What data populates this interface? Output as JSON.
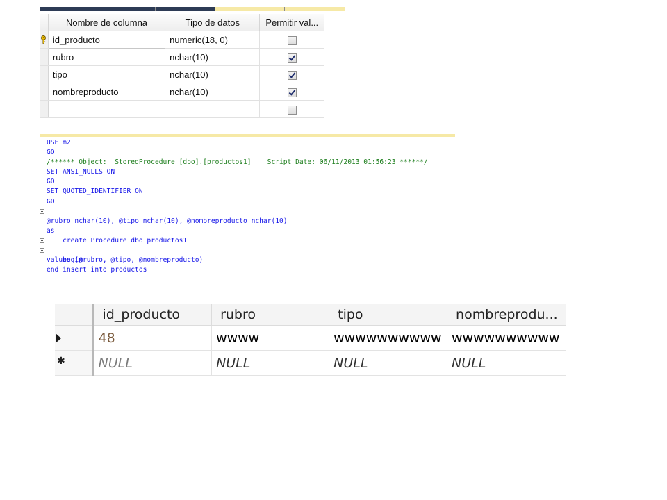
{
  "designer": {
    "headers": [
      "Nombre de columna",
      "Tipo de datos",
      "Permitir val..."
    ],
    "rows": [
      {
        "name": "id_producto",
        "type": "numeric(18, 0)",
        "allow_nulls": false,
        "primary_key": true
      },
      {
        "name": "rubro",
        "type": "nchar(10)",
        "allow_nulls": true
      },
      {
        "name": "tipo",
        "type": "nchar(10)",
        "allow_nulls": true
      },
      {
        "name": "nombreproducto",
        "type": "nchar(10)",
        "allow_nulls": true
      },
      {
        "name": "",
        "type": "",
        "allow_nulls": false
      }
    ]
  },
  "sql": {
    "lines": [
      "USE m2",
      "GO",
      "/****** Object:  StoredProcedure [dbo].[productos1]    Script Date: 06/11/2013 01:56:23 ******/",
      "SET ANSI_NULLS ON",
      "GO",
      "SET QUOTED_IDENTIFIER ON",
      "GO",
      "create Procedure dbo_productos1",
      "@rubro nchar(10), @tipo nchar(10), @nombreproducto nchar(10)",
      "as",
      "begin",
      "insert into productos",
      "values (@rubro, @tipo, @nombreproducto)",
      "end"
    ]
  },
  "results": {
    "headers": [
      "id_producto",
      "rubro",
      "tipo",
      "nombreprodu..."
    ],
    "rows": [
      [
        "48",
        "wwww",
        "wwwwwwwwww",
        "wwwwwwwwww"
      ],
      [
        "NULL",
        "NULL",
        "NULL",
        "NULL"
      ]
    ]
  },
  "colors": {
    "keyword": "#1515e8",
    "comment": "#1b7d1b",
    "operator": "#777777",
    "identifier": "#2b7d8a",
    "designer_header_bar": "#2d3b55",
    "editor_margin_bar": "#f6e9a6"
  },
  "icons": {
    "primary_key": "key-icon",
    "current_row": "row-arrow-icon",
    "new_row": "new-row-star-icon"
  }
}
